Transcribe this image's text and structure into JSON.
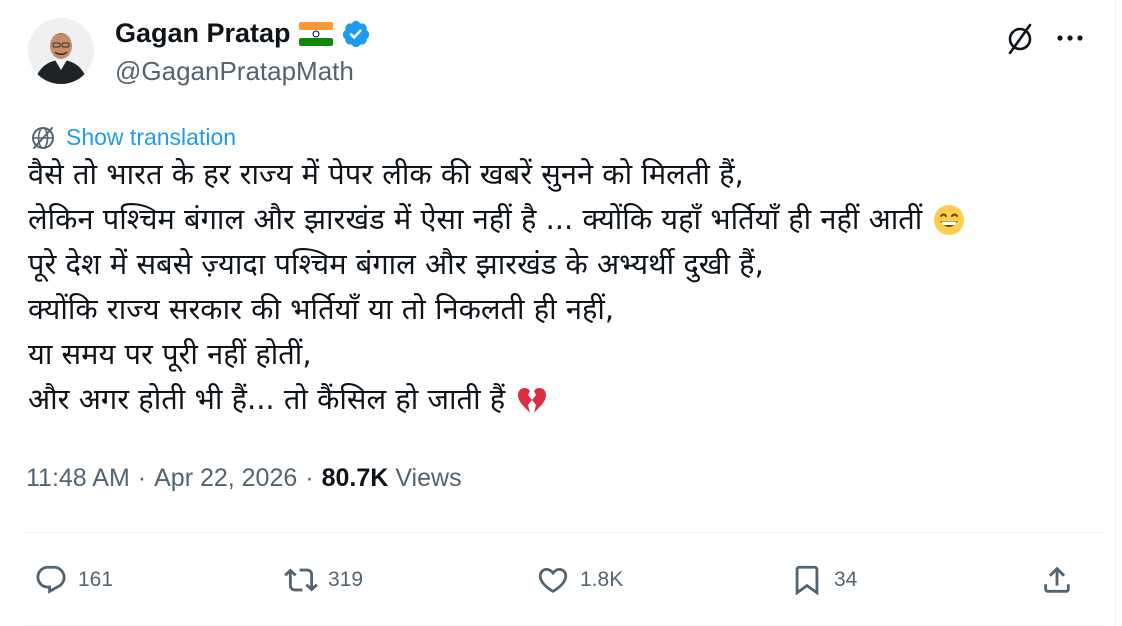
{
  "author": {
    "name": "Gagan Pratap",
    "handle": "@GaganPratapMath",
    "flag_icon": "india-flag-icon",
    "verified_icon": "verified-badge-icon"
  },
  "header_actions": {
    "grok_icon": "grok-icon",
    "more_icon": "more-options-icon"
  },
  "translation": {
    "label": "Show translation",
    "icon": "globe-icon"
  },
  "tweet": {
    "lines": [
      "वैसे तो भारत के हर राज्य में पेपर लीक की खबरें सुनने को मिलती हैं,",
      "लेकिन पश्चिम बंगाल और झारखंड में ऐसा नहीं है ... क्योंकि यहाँ भर्तियाँ ही नहीं आतीं",
      "पूरे देश में सबसे ज़्यादा पश्चिम बंगाल और झारखंड के अभ्यर्थी दुखी हैं,",
      "क्योंकि राज्य सरकार की भर्तियाँ या तो निकलती ही नहीं,",
      "या समय पर पूरी नहीं होतीं,",
      "और अगर होती भी हैं... तो कैंसिल हो जाती हैं"
    ],
    "emoji_line2": "grinning-face-emoji",
    "emoji_line6": "broken-heart-emoji"
  },
  "meta": {
    "time": "11:48 AM",
    "separator": "·",
    "date": "Apr 22, 2026",
    "views_count": "80.7K",
    "views_label": "Views"
  },
  "actions": {
    "replies": "161",
    "reposts": "319",
    "likes": "1.8K",
    "bookmarks": "34"
  },
  "colors": {
    "accent": "#1d9bf0",
    "text_primary": "#0f1419",
    "text_secondary": "#536471",
    "divider": "#eff3f4",
    "heart_red": "#e0245e"
  }
}
